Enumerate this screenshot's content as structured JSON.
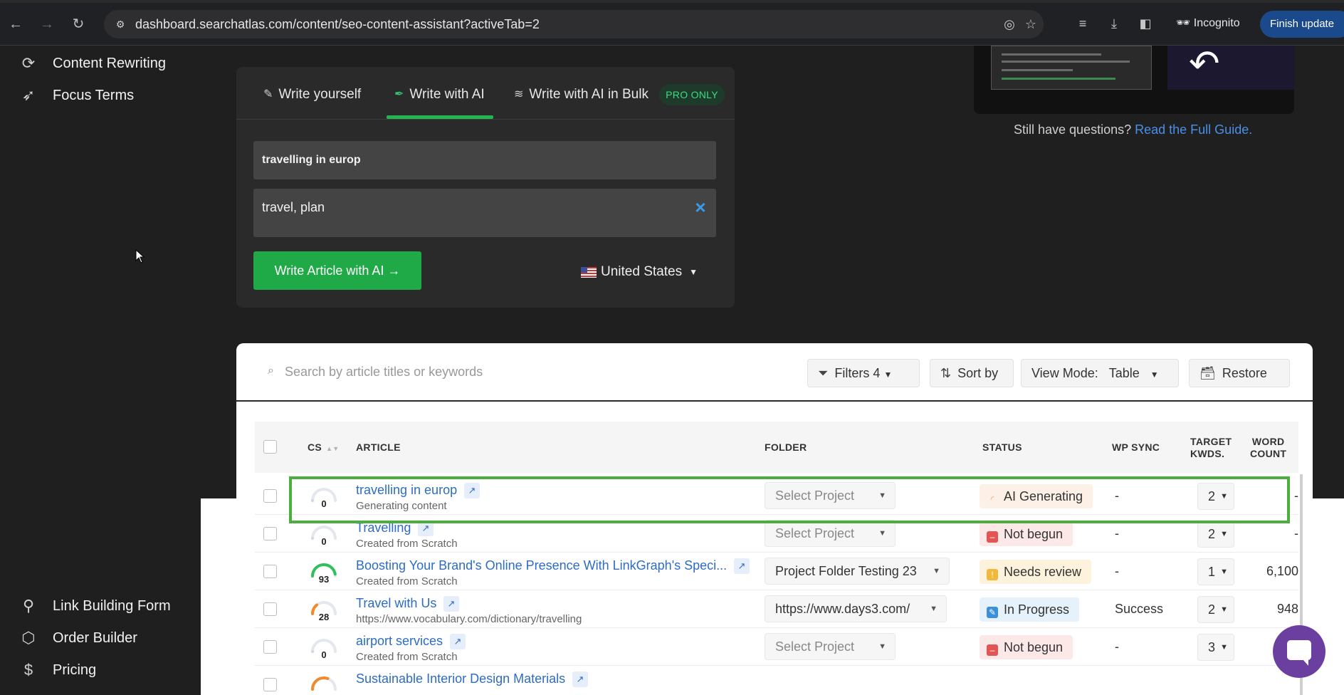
{
  "browser": {
    "url": "dashboard.searchatlas.com/content/seo-content-assistant?activeTab=2",
    "incognito_label": "Incognito",
    "finish_update_label": "Finish update"
  },
  "sidebar": {
    "top_items": [
      {
        "label": "Content Rewriting",
        "icon": "refresh-icon"
      },
      {
        "label": "Focus Terms",
        "icon": "rocket-icon"
      }
    ],
    "bottom_items": [
      {
        "label": "Link Building Form",
        "icon": "link-building-icon"
      },
      {
        "label": "Order Builder",
        "icon": "cubes-icon"
      },
      {
        "label": "Pricing",
        "icon": "dollar-icon"
      }
    ]
  },
  "write_panel": {
    "tabs": [
      {
        "label": "Write yourself",
        "icon": "pencil-icon"
      },
      {
        "label": "Write with AI",
        "icon": "leaf-pen-icon",
        "active": true
      },
      {
        "label": "Write with AI in Bulk",
        "icon": "layers-icon"
      }
    ],
    "pro_badge": "PRO ONLY",
    "title_value": "travelling in europ",
    "keywords_value": "travel, plan",
    "write_button": "Write Article with AI →",
    "country": "United States"
  },
  "help": {
    "question": "Still have questions?",
    "link": "Read the Full Guide."
  },
  "toolbar": {
    "search_placeholder": "Search by article titles or keywords",
    "filters_label": "Filters 4",
    "sort_label": "Sort by",
    "view_mode_label": "View Mode:",
    "view_mode_value": "Table",
    "restore_label": "Restore"
  },
  "table": {
    "headers": {
      "cs": "CS",
      "article": "ARTICLE",
      "folder": "FOLDER",
      "status": "STATUS",
      "wp_sync": "WP SYNC",
      "target_kwds_1": "TARGET",
      "target_kwds_2": "KWDS.",
      "word_count_1": "WORD",
      "word_count_2": "COUNT"
    },
    "rows": [
      {
        "cs": "0",
        "cs_value": 0,
        "title": "travelling in europ",
        "subtitle": "Generating content",
        "folder": "Select Project",
        "status": "AI Generating",
        "wp_sync": "-",
        "kwds": "2",
        "word_count": "-"
      },
      {
        "cs": "0",
        "cs_value": 0,
        "title": "Travelling",
        "subtitle": "Created from Scratch",
        "folder": "Select Project",
        "status": "Not begun",
        "wp_sync": "-",
        "kwds": "2",
        "word_count": "-"
      },
      {
        "cs": "93",
        "cs_value": 93,
        "title": "Boosting Your Brand's Online Presence With LinkGraph's Speci...",
        "subtitle": "Created from Scratch",
        "folder": "Project Folder Testing 23",
        "status": "Needs review",
        "wp_sync": "-",
        "kwds": "1",
        "word_count": "6,100"
      },
      {
        "cs": "28",
        "cs_value": 28,
        "title": "Travel with Us",
        "subtitle": "https://www.vocabulary.com/dictionary/travelling",
        "folder": "https://www.days3.com/",
        "status": "In Progress",
        "wp_sync": "Success",
        "kwds": "2",
        "word_count": "948"
      },
      {
        "cs": "0",
        "cs_value": 0,
        "title": "airport services",
        "subtitle": "Created from Scratch",
        "folder": "Select Project",
        "status": "Not begun",
        "wp_sync": "-",
        "kwds": "3",
        "word_count": ""
      },
      {
        "cs": "",
        "cs_value": 60,
        "title": "Sustainable Interior Design Materials",
        "subtitle": "",
        "folder": "",
        "status": "",
        "wp_sync": "",
        "kwds": "",
        "word_count": ""
      }
    ]
  },
  "colors": {
    "accent_green": "#1faa47",
    "link_blue": "#2d6cc4",
    "highlight_green": "#4cae3f",
    "chat_purple": "#6b3fa0"
  }
}
